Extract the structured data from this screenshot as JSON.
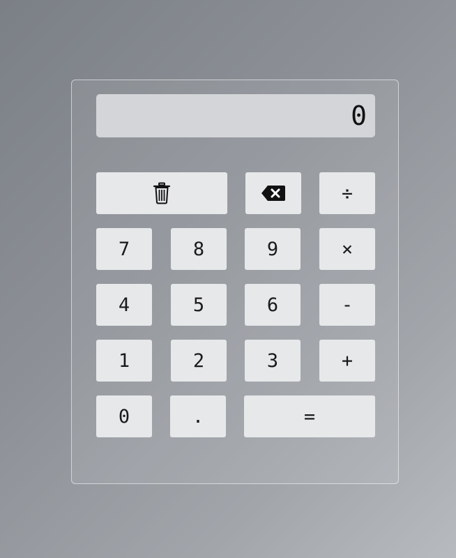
{
  "display": {
    "value": "0"
  },
  "keys": {
    "clear": {
      "icon": "trash-icon"
    },
    "backspace": {
      "icon": "backspace-icon"
    },
    "divide": "÷",
    "seven": "7",
    "eight": "8",
    "nine": "9",
    "multiply": "×",
    "four": "4",
    "five": "5",
    "six": "6",
    "subtract": "-",
    "one": "1",
    "two": "2",
    "three": "3",
    "add": "+",
    "zero": "0",
    "decimal": ".",
    "equals": "="
  },
  "colors": {
    "key_background": "#e7e8ea",
    "display_background": "#d3d5d8",
    "text": "#1a1a1a"
  }
}
